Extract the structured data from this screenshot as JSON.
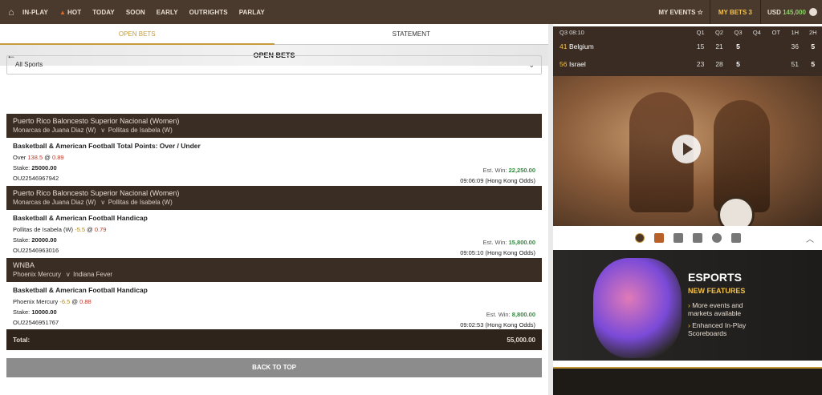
{
  "nav": {
    "home_icon": "home-icon",
    "items": [
      "IN-PLAY",
      "HOT",
      "TODAY",
      "SOON",
      "EARLY",
      "OUTRIGHTS",
      "PARLAY"
    ],
    "my_events": "MY EVENTS ☆",
    "my_bets": "MY BETS 3",
    "currency": "USD",
    "balance": "145,000"
  },
  "tabs": {
    "open_bets": "OPEN BETS",
    "statement": "STATEMENT"
  },
  "page_title": "OPEN BETS",
  "filter": {
    "selected": "All Sports"
  },
  "bets": [
    {
      "league": "Puerto Rico Baloncesto Superior Nacional (Women)",
      "home": "Monarcas de Juana Diaz (W)",
      "vs": "v",
      "away": "Pollitas de Isabela (W)",
      "market": "Basketball & American Football Total Points: Over / Under",
      "selection": "Over",
      "line": "138.5",
      "at": "@",
      "odds": "0.89",
      "stake_label": "Stake:",
      "stake": "25000.00",
      "estwin_label": "Est. Win:",
      "estwin": "22,250.00",
      "ref": "OU22546967942",
      "time": "09:06:09 (Hong Kong Odds)"
    },
    {
      "league": "Puerto Rico Baloncesto Superior Nacional (Women)",
      "home": "Monarcas de Juana Diaz (W)",
      "vs": "v",
      "away": "Pollitas de Isabela (W)",
      "market": "Basketball & American Football Handicap",
      "selection": "Pollitas de Isabela (W)",
      "line": "-5.5",
      "at": "@",
      "odds": "0.79",
      "stake_label": "Stake:",
      "stake": "20000.00",
      "estwin_label": "Est. Win:",
      "estwin": "15,800.00",
      "ref": "OU22546963016",
      "time": "09:05:10 (Hong Kong Odds)"
    },
    {
      "league": "WNBA",
      "home": "Phoenix Mercury",
      "vs": "v",
      "away": "Indiana Fever",
      "market": "Basketball & American Football Handicap",
      "selection": "Phoenix Mercury",
      "line": "-6.5",
      "at": "@",
      "odds": "0.88",
      "stake_label": "Stake:",
      "stake": "10000.00",
      "estwin_label": "Est. Win:",
      "estwin": "8,800.00",
      "ref": "OU22546951767",
      "time": "09:02:53 (Hong Kong Odds)"
    }
  ],
  "total": {
    "label": "Total:",
    "value": "55,000.00"
  },
  "back_to_top": "BACK TO TOP",
  "scoreboard": {
    "period": "Q3 08:10",
    "headers": [
      "Q1",
      "Q2",
      "Q3",
      "Q4",
      "OT",
      "1H",
      "2H"
    ],
    "teams": [
      {
        "score": "41",
        "name": "Belgium",
        "q": [
          "15",
          "21",
          "5",
          "",
          "",
          "36",
          "5"
        ]
      },
      {
        "score": "56",
        "name": "Israel",
        "q": [
          "23",
          "28",
          "5",
          "",
          "",
          "51",
          "5"
        ]
      }
    ]
  },
  "media_icons": [
    "play-video-icon",
    "court-icon",
    "stats-icon",
    "microphone-icon",
    "versus-icon",
    "scoreboard-icon"
  ],
  "promo": {
    "title": "ESPORTS",
    "subtitle": "NEW FEATURES",
    "points": [
      "More events and markets available",
      "Enhanced In-Play Scoreboards"
    ]
  }
}
